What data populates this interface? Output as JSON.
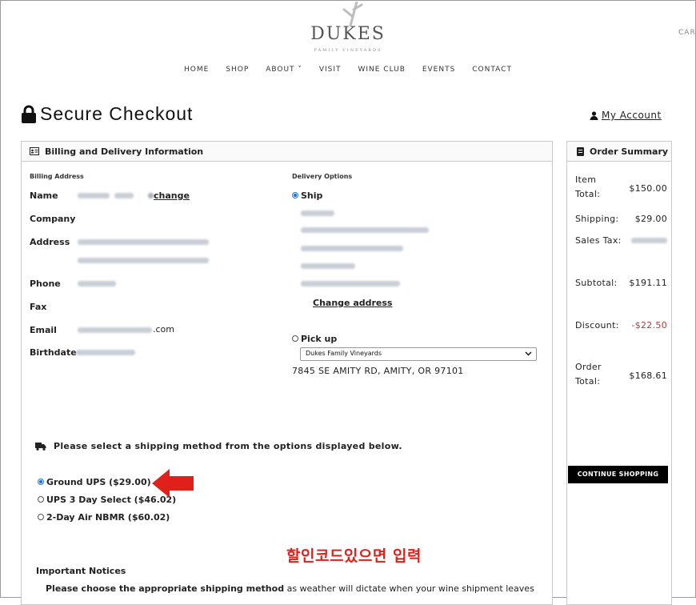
{
  "brand": {
    "name": "DUKES",
    "tagline": "FAMILY VINEYARDS",
    "cart": "CAR"
  },
  "nav": {
    "items": [
      "HOME",
      "SHOP",
      "ABOUT ˅",
      "VISIT",
      "WINE CLUB",
      "EVENTS",
      "CONTACT"
    ]
  },
  "header": {
    "title": "Secure Checkout",
    "account_label": "My Account"
  },
  "billing_panel": {
    "title": "Billing and Delivery Information",
    "billing_heading": "Billing Address",
    "name_label": "Name",
    "change_link": "change",
    "company_label": "Company",
    "address_label": "Address",
    "phone_label": "Phone",
    "fax_label": "Fax",
    "email_label": "Email",
    "email_suffix": ".com",
    "birthdate_label": "Birthdate"
  },
  "delivery": {
    "heading": "Delivery Options",
    "ship_label": "Ship",
    "change_address": "Change address",
    "pickup_label": "Pick up",
    "pickup_location": "Dukes Family Vineyards",
    "pickup_address": "7845 SE AMITY RD, AMITY, OR 97101"
  },
  "shipping": {
    "prompt": "Please select a shipping method from the options displayed below.",
    "options": [
      {
        "label": "Ground UPS ($29.00)",
        "selected": true
      },
      {
        "label": "UPS 3 Day Select ($46.02)",
        "selected": false
      },
      {
        "label": "2-Day Air NBMR ($60.02)",
        "selected": false
      }
    ]
  },
  "notices": {
    "heading": "Important Notices",
    "text_bold": "Please choose the appropriate shipping method",
    "text_rest": " as weather will dictate when your wine shipment leaves"
  },
  "annotation": {
    "korean_note": "할인코드있으면 입력"
  },
  "order_summary": {
    "title": "Order Summary",
    "item_total_label_1": "Item",
    "item_total_label_2": "Total:",
    "item_total": "$150.00",
    "shipping_label": "Shipping:",
    "shipping": "$29.00",
    "sales_tax_label": "Sales Tax:",
    "subtotal_label": "Subtotal:",
    "subtotal": "$191.11",
    "discount_label": "Discount:",
    "discount": "-$22.50",
    "order_total_label_1": "Order",
    "order_total_label_2": "Total:",
    "order_total": "$168.61",
    "continue_button": "CONTINUE SHOPPING"
  },
  "colors": {
    "accent_radio": "#1a73e8",
    "discount_red": "#b23a3a",
    "annotation_red": "#e0201b"
  }
}
